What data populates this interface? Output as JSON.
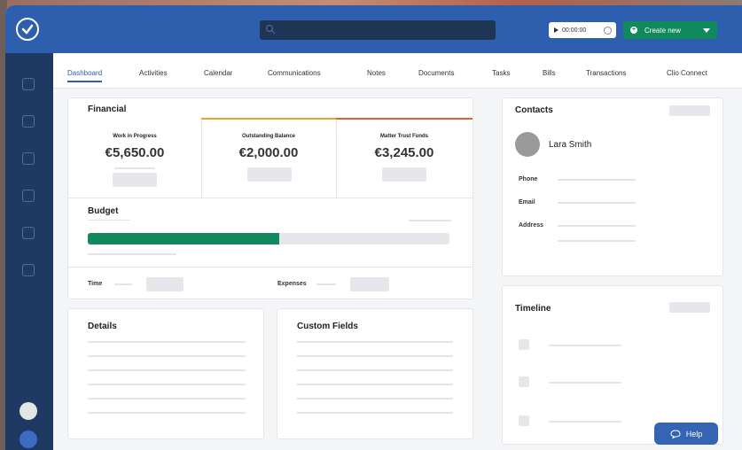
{
  "topbar": {
    "timer_value": "00:00:00",
    "create_label": "Create new"
  },
  "tabs": [
    "Dashboard",
    "Activities",
    "Calendar",
    "Communications",
    "Notes",
    "Documents",
    "Tasks",
    "Bills",
    "Transactions",
    "Clio Connect"
  ],
  "financial": {
    "title": "Financial",
    "items": [
      {
        "label": "Work in Progress",
        "value": "€5,650.00"
      },
      {
        "label": "Outstanding Balance",
        "value": "€2,000.00"
      },
      {
        "label": "Matter Trust Funds",
        "value": "€3,245.00"
      }
    ],
    "accent_colors": [
      "#e6a52a",
      "#e0622e"
    ]
  },
  "budget": {
    "title": "Budget",
    "progress": 0.53,
    "bar_color": "#108a5d",
    "time_label": "Time",
    "expenses_label": "Expenses"
  },
  "details": {
    "title": "Details"
  },
  "custom_fields": {
    "title": "Custom Fields"
  },
  "contacts": {
    "title": "Contacts",
    "name": "Lara Smith",
    "fields": [
      "Phone",
      "Email",
      "Address"
    ]
  },
  "timeline": {
    "title": "Timeline"
  },
  "help": {
    "label": "Help"
  },
  "icons": [
    "app-logo-icon",
    "search-icon",
    "play-icon",
    "clock-icon",
    "plus-icon",
    "caret-down-icon",
    "help-icon"
  ]
}
